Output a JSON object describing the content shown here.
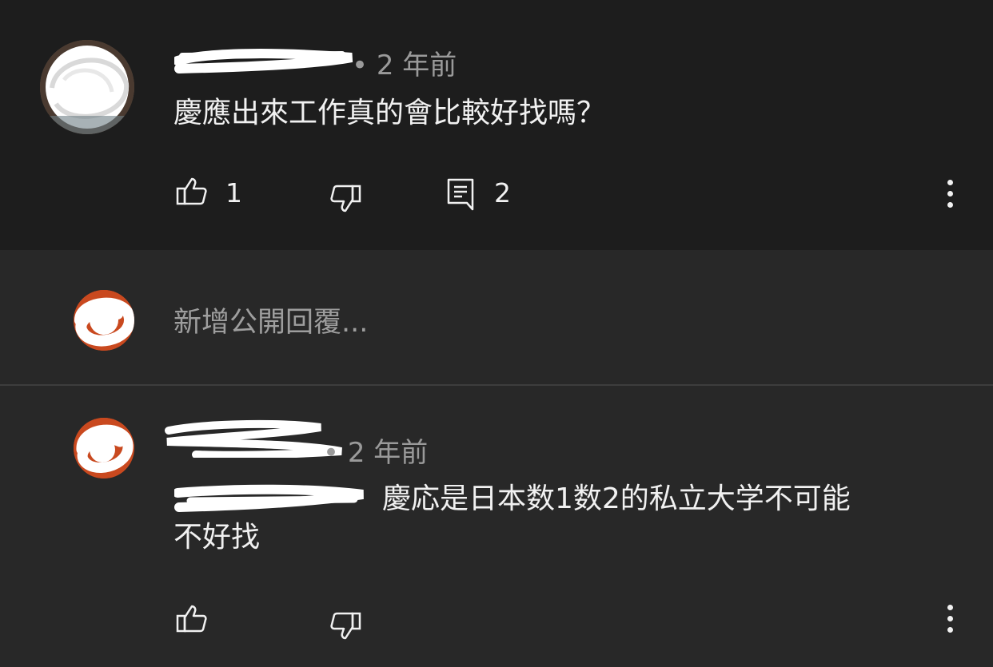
{
  "comment": {
    "time": "• 2 年前",
    "text": "慶應出來工作真的會比較好找嗎？",
    "likes": "1",
    "replies": "2"
  },
  "reply_input": {
    "placeholder": "新增公開回覆..."
  },
  "reply": {
    "time": "• 2 年前",
    "text_line1": "慶応是日本数1数2的私立大学不可能",
    "text_line2": "不好找"
  },
  "icons": {
    "like": "thumbs-up-icon",
    "dislike": "thumbs-down-icon",
    "reply": "comment-icon",
    "menu": "more-vertical-icon"
  }
}
